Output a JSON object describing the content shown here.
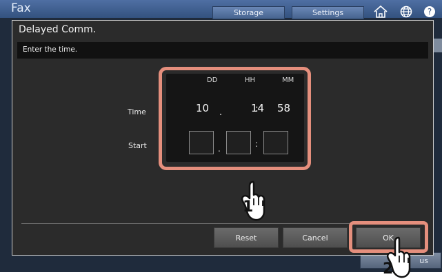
{
  "background_app": {
    "title": "Fax",
    "tabs": [
      "Storage",
      "Settings"
    ],
    "icons": [
      "home-icon",
      "globe-icon",
      "help-icon"
    ],
    "bottom_button_label": "us"
  },
  "dialog": {
    "title": "Delayed Comm.",
    "message": "Enter the time.",
    "headers": {
      "dd": "DD",
      "hh": "HH",
      "mm": "MM"
    },
    "rows": {
      "time_label": "Time",
      "start_label": "Start"
    },
    "time": {
      "dd": "10",
      "hh": "14",
      "mm": "58",
      "sep1": ".",
      "sep2": ":"
    },
    "start": {
      "dd": "",
      "hh": "",
      "mm": "",
      "sep1": ".",
      "sep2": ":"
    },
    "buttons": {
      "reset": "Reset",
      "cancel": "Cancel",
      "ok": "OK"
    }
  },
  "callouts": {
    "step_1": "1",
    "step_2": "2"
  },
  "colors": {
    "highlight": "#e58f7d",
    "dialog_background": "#2b2b2b",
    "panel_background": "#151515"
  }
}
